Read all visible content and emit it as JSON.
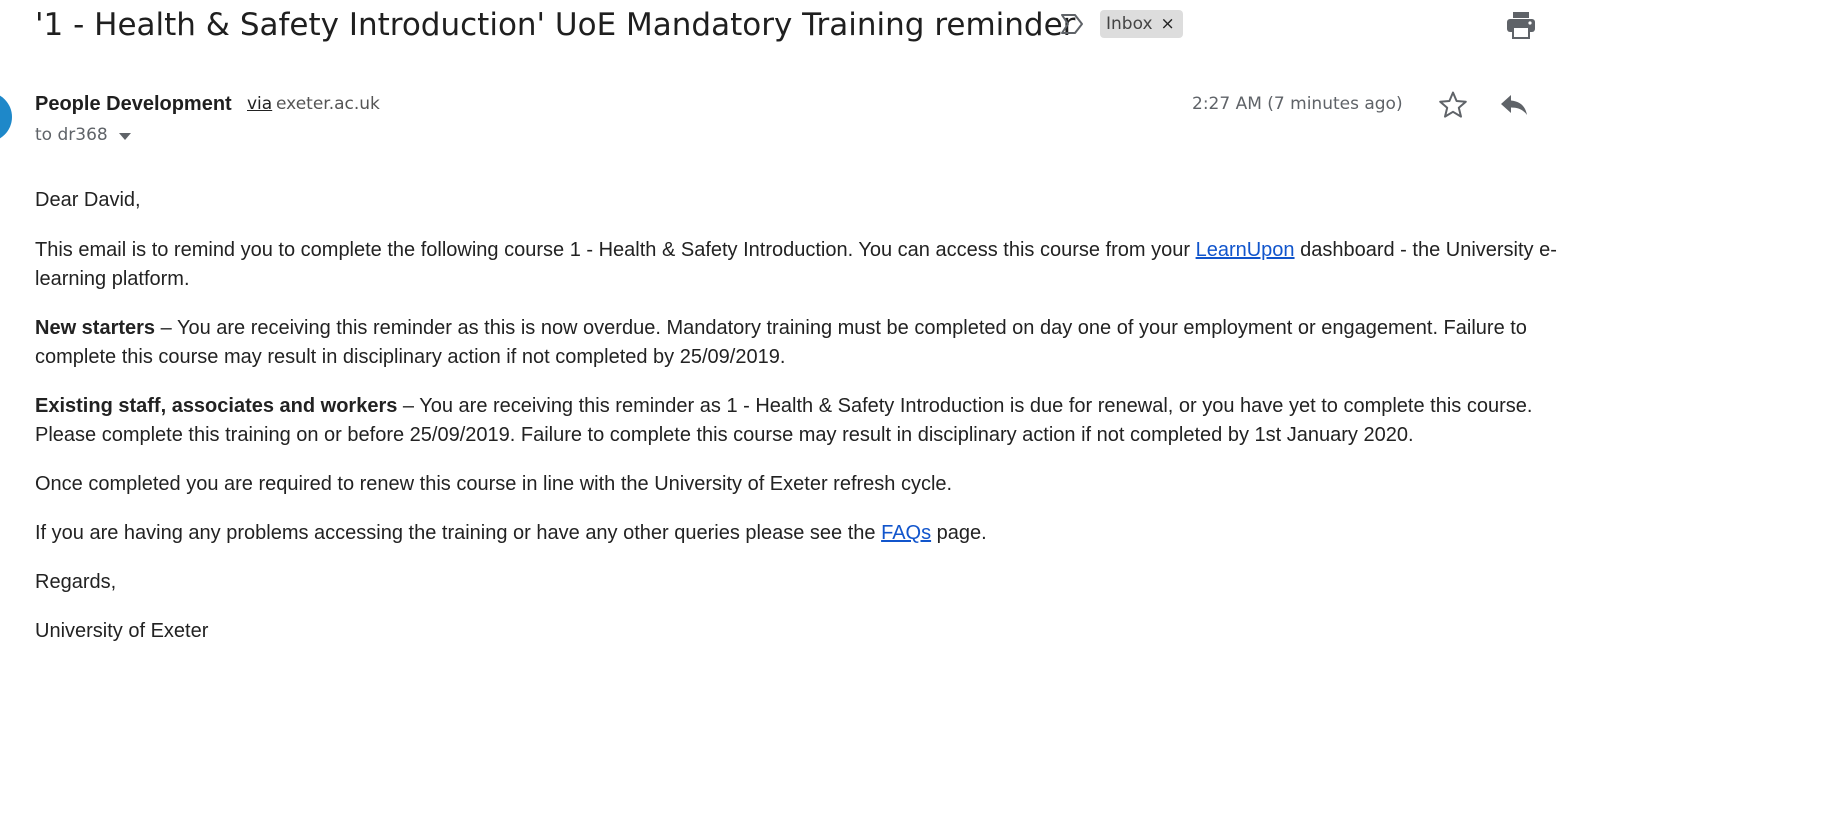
{
  "subject": "'1 - Health & Safety Introduction' UoE Mandatory Training reminder",
  "label_chip": "Inbox",
  "label_chip_remove": "×",
  "icons": {
    "importance": "importance-marker-icon",
    "print": "print-icon",
    "star": "star-icon",
    "reply": "reply-icon",
    "caret": "chevron-down-icon"
  },
  "sender": {
    "name": "People Development",
    "via": "via",
    "domain": "exeter.ac.uk",
    "recipient": "to dr368",
    "time": "2:27 AM (7 minutes ago)",
    "avatar_color": "#1e88c9"
  },
  "message": {
    "greeting": "Dear David,",
    "p1_before": "This email is to remind you to complete the following course 1 - Health & Safety Introduction. You can access this course from your ",
    "p1_link": "LearnUpon",
    "p1_after": " dashboard - the University e-learning platform.",
    "p2_bold": "New starters",
    "p2_text": " – You are receiving this reminder as this is now overdue. Mandatory training must be completed on day one of your employment or engagement. Failure to complete this course may result in disciplinary action if not completed by 25/09/2019.",
    "p3_bold": "Existing staff, associates and workers",
    "p3_text": " – You are receiving this reminder as 1 - Health & Safety Introduction is due for renewal, or you have yet to complete this course. Please complete this training on or before 25/09/2019. Failure to complete this course may result in disciplinary action if not completed by 1st January 2020.",
    "p4": "Once completed you are required to renew this course in line with the University of Exeter refresh cycle.",
    "p5_before": "If you are having any problems accessing the training or have any other queries please see the ",
    "p5_link": "FAQs",
    "p5_after": " page.",
    "closing": "Regards,",
    "signature": "University of Exeter"
  },
  "colors": {
    "link": "#1155cc",
    "chip_bg": "#dddddd",
    "secondary_text": "#5f6368"
  }
}
